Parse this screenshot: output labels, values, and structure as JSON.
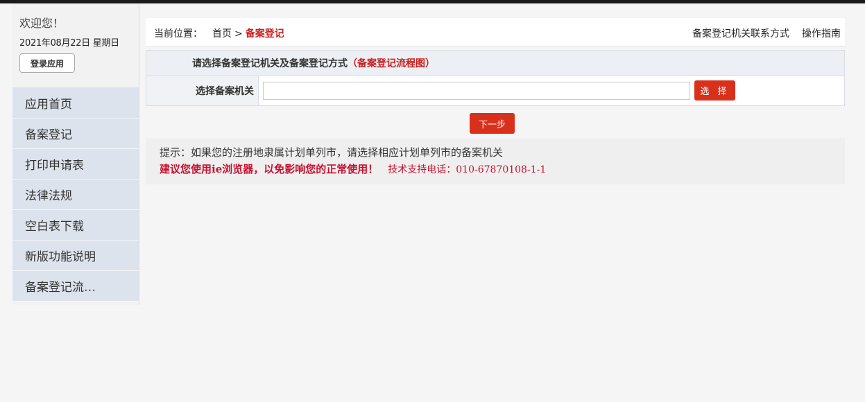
{
  "sidebar": {
    "welcome": "欢迎您！",
    "date": "2021年08月22日  星期日",
    "login_label": "登录应用",
    "items": [
      {
        "label": "应用首页"
      },
      {
        "label": "备案登记"
      },
      {
        "label": "打印申请表"
      },
      {
        "label": "法律法规"
      },
      {
        "label": "空白表下载"
      },
      {
        "label": "新版功能说明"
      },
      {
        "label": "备案登记流…"
      }
    ]
  },
  "breadcrumb": {
    "prefix": "当前位置：",
    "home": "首页",
    "separator": ">",
    "current": "备案登记"
  },
  "top_links": {
    "contact": "备案登记机关联系方式",
    "guide": "操作指南"
  },
  "form": {
    "heading": "请选择备案登记机关及备案登记方式",
    "flow_link": "（备案登记流程图）",
    "org_label": "选择备案机关",
    "org_value": "",
    "select_label": "选 择"
  },
  "next_label": "下一步",
  "tips": {
    "hint": "提示：如果您的注册地隶属计划单列市，请选择相应计划单列市的备案机关",
    "warning": "建议您使用ie浏览器，以免影响您的正常使用！",
    "support": "技术支持电话：010-67870108-1-1"
  },
  "colors": {
    "accent_red": "#d9301c",
    "sidebar_item_bg": "#dde3ec"
  }
}
